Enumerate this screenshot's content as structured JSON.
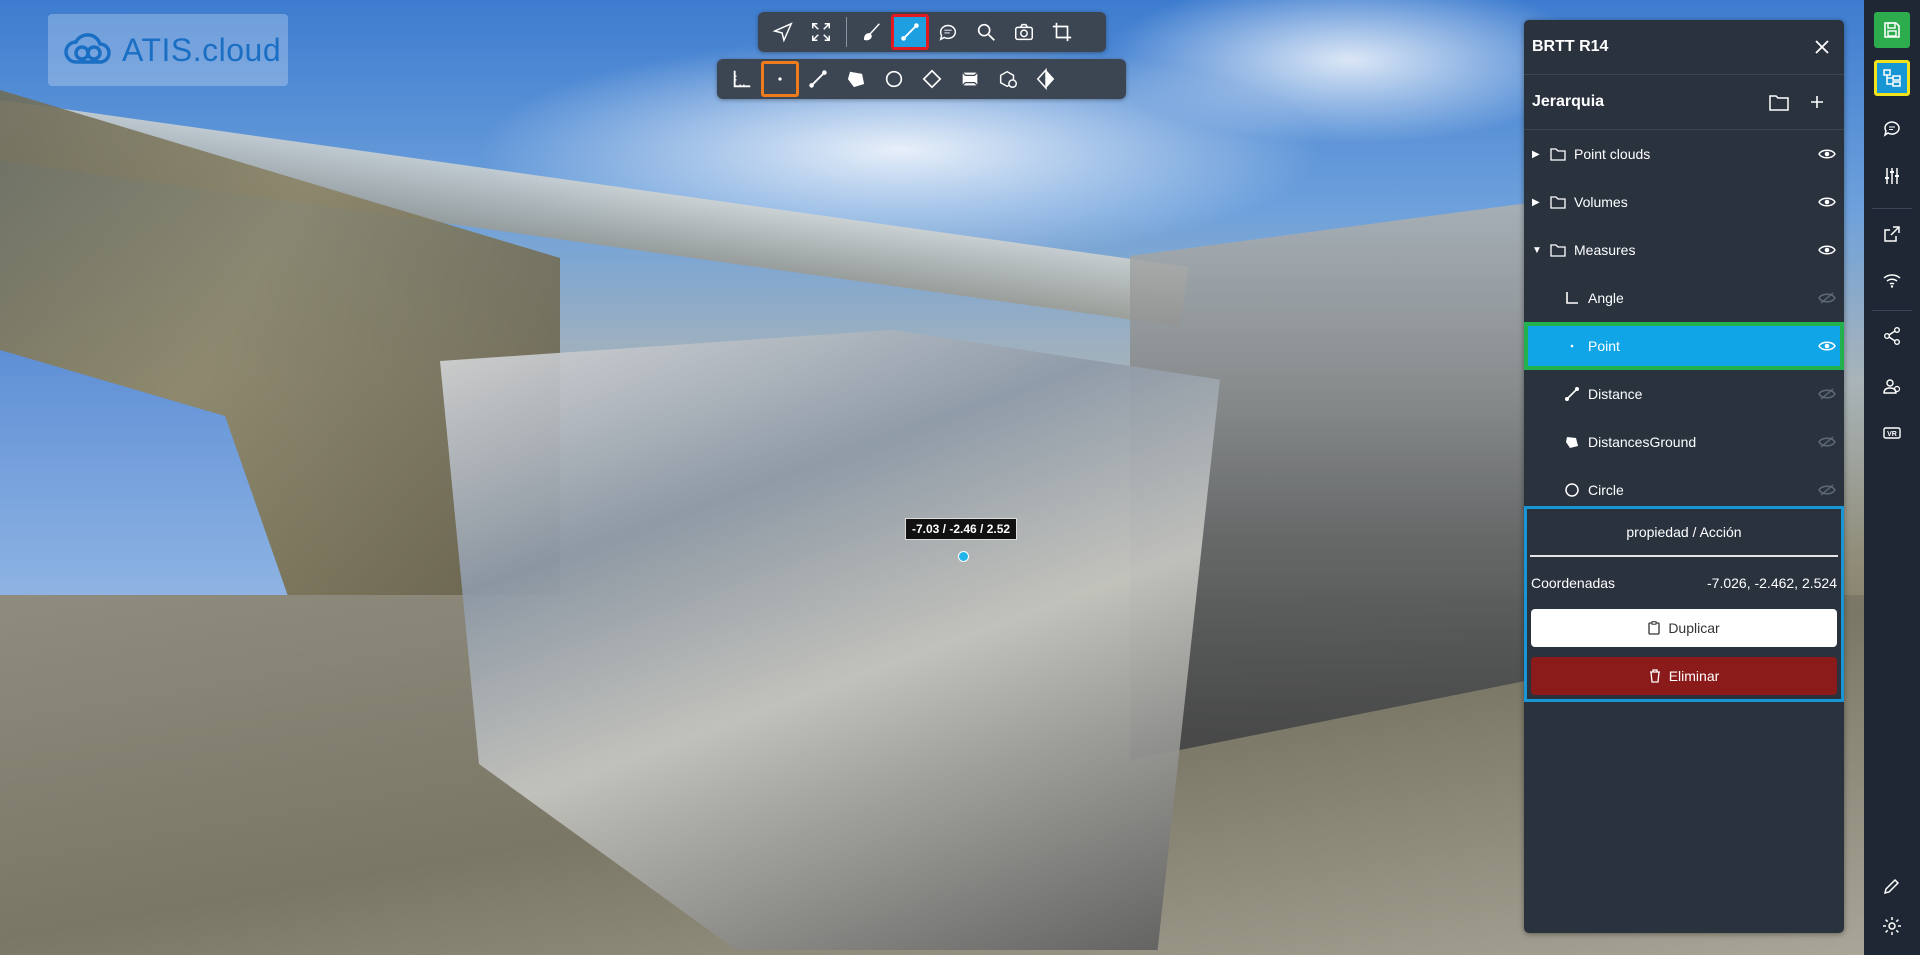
{
  "app": {
    "logo_text": "ATIS.cloud"
  },
  "toolbar_top": {
    "tools": [
      {
        "name": "navigate-icon"
      },
      {
        "name": "fullscreen-icon"
      },
      {
        "name": "brush-icon"
      },
      {
        "name": "measure-icon",
        "state": "selected"
      },
      {
        "name": "comment-icon"
      },
      {
        "name": "search-icon"
      },
      {
        "name": "camera-icon"
      },
      {
        "name": "crop-icon"
      }
    ]
  },
  "toolbar_bottom": {
    "tools": [
      {
        "name": "angle-icon"
      },
      {
        "name": "point-icon",
        "state": "selected"
      },
      {
        "name": "distance-icon"
      },
      {
        "name": "area-icon"
      },
      {
        "name": "circle-icon"
      },
      {
        "name": "diamond-icon"
      },
      {
        "name": "volume-icon"
      },
      {
        "name": "profile-icon"
      },
      {
        "name": "contrast-icon"
      }
    ]
  },
  "viewport": {
    "coordinate_tag": "-7.03 / -2.46 / 2.52"
  },
  "panel": {
    "title": "BRTT R14",
    "hierarchy": {
      "title": "Jerarquia",
      "items": [
        {
          "label": "Point clouds",
          "type": "folder",
          "expanded": false,
          "visible": true
        },
        {
          "label": "Volumes",
          "type": "folder",
          "expanded": false,
          "visible": true
        },
        {
          "label": "Measures",
          "type": "folder",
          "expanded": true,
          "visible": true
        },
        {
          "label": "Angle",
          "type": "angle",
          "visible": false
        },
        {
          "label": "Point",
          "type": "point",
          "visible": true,
          "selected": true
        },
        {
          "label": "Distance",
          "type": "distance",
          "visible": false
        },
        {
          "label": "DistancesGround",
          "type": "area",
          "visible": false
        },
        {
          "label": "Circle",
          "type": "circle",
          "visible": false
        }
      ]
    },
    "properties": {
      "header": "propiedad / Acción",
      "coord_label": "Coordenadas",
      "coord_value": "-7.026, -2.462, 2.524",
      "duplicate_label": "Duplicar",
      "delete_label": "Eliminar"
    }
  },
  "rail": {
    "icons": [
      "save-icon",
      "hierarchy-icon",
      "comments-icon",
      "settings-sliders-icon",
      "export-icon",
      "wifi-icon",
      "share-icon",
      "users-icon",
      "vr-icon",
      "pencil-icon",
      "gear-icon"
    ]
  },
  "colors": {
    "accent": "#10a5e6",
    "panel_bg": "#2a323e",
    "danger": "#8b1a1a",
    "save_green": "#2dac4d"
  }
}
